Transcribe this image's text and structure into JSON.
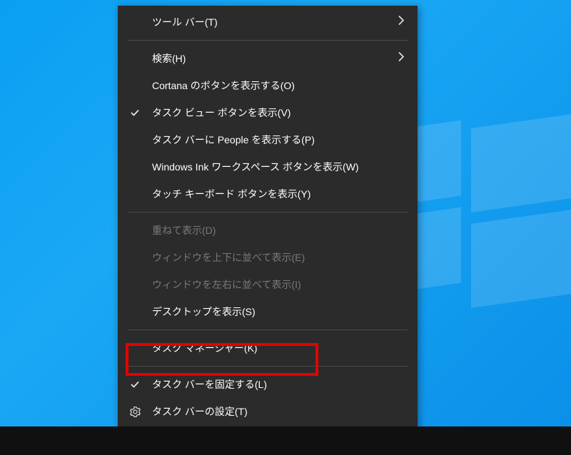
{
  "menu": {
    "toolbars": {
      "label": "ツール バー(T)",
      "submenu": true
    },
    "search": {
      "label": "検索(H)",
      "submenu": true
    },
    "cortana": {
      "label": "Cortana のボタンを表示する(O)"
    },
    "taskview": {
      "label": "タスク ビュー ボタンを表示(V)",
      "checked": true
    },
    "people": {
      "label": "タスク バーに People を表示する(P)"
    },
    "ink": {
      "label": "Windows Ink ワークスペース ボタンを表示(W)"
    },
    "touchkb": {
      "label": "タッチ キーボード ボタンを表示(Y)"
    },
    "cascade": {
      "label": "重ねて表示(D)",
      "disabled": true
    },
    "stackv": {
      "label": "ウィンドウを上下に並べて表示(E)",
      "disabled": true
    },
    "stackh": {
      "label": "ウィンドウを左右に並べて表示(I)",
      "disabled": true
    },
    "showdesktop": {
      "label": "デスクトップを表示(S)"
    },
    "taskmgr": {
      "label": "タスク マネージャー(K)"
    },
    "lock": {
      "label": "タスク バーを固定する(L)",
      "checked": true
    },
    "settings": {
      "label": "タスク バーの設定(T)",
      "gear": true
    }
  }
}
